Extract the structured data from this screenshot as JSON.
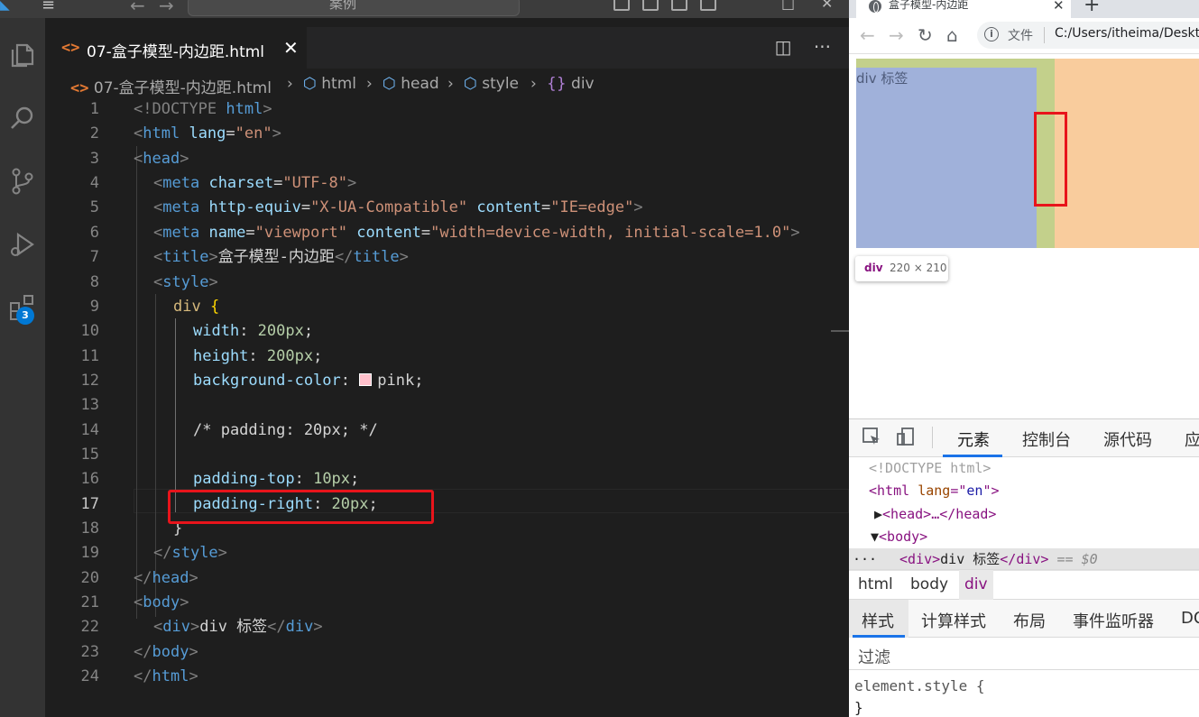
{
  "vscode": {
    "command_center_text": "案例",
    "tab": {
      "label": "07-盒子模型-内边距.html",
      "close": "✕",
      "icon_text": "<>"
    },
    "tab_actions": {
      "split": "◫",
      "more": "···"
    },
    "extensions_badge": "3",
    "breadcrumb": [
      {
        "label": "07-盒子模型-内边距.html",
        "icon": "html-file-icon"
      },
      {
        "label": "html",
        "icon": "cube-icon"
      },
      {
        "label": "head",
        "icon": "cube-icon"
      },
      {
        "label": "style",
        "icon": "cube-icon"
      },
      {
        "label": "div",
        "icon": "selector-icon"
      }
    ],
    "current_line": 17,
    "code_lines": [
      "1",
      "2",
      "3",
      "4",
      "5",
      "6",
      "7",
      "8",
      "9",
      "10",
      "11",
      "12",
      "13",
      "14",
      "15",
      "16",
      "17",
      "18",
      "19",
      "20",
      "21",
      "22",
      "23",
      "24"
    ],
    "code": {
      "l1": [
        "<!DOCTYPE ",
        "html",
        ">"
      ],
      "l2": [
        "<",
        "html",
        " ",
        "lang",
        "=",
        "\"en\"",
        ">"
      ],
      "l3": [
        "<",
        "head",
        ">"
      ],
      "l4": [
        "<",
        "meta",
        " ",
        "charset",
        "=",
        "\"UTF-8\"",
        ">"
      ],
      "l5": [
        "<",
        "meta",
        " ",
        "http-equiv",
        "=",
        "\"X-UA-Compatible\"",
        " ",
        "content",
        "=",
        "\"IE=edge\"",
        ">"
      ],
      "l6": [
        "<",
        "meta",
        " ",
        "name",
        "=",
        "\"viewport\"",
        " ",
        "content",
        "=",
        "\"width=device-width, initial-scale=1.0\"",
        ">"
      ],
      "l7": [
        "<",
        "title",
        ">",
        "盒子模型-内边距",
        "</",
        "title",
        ">"
      ],
      "l8": [
        "<",
        "style",
        ">"
      ],
      "l9": [
        "div",
        " {"
      ],
      "l10": [
        "width",
        ": ",
        "200px",
        ";"
      ],
      "l11": [
        "height",
        ": ",
        "200px",
        ";"
      ],
      "l12": [
        "background-color",
        ": ",
        "pink",
        ";"
      ],
      "l14": "/* padding: 20px; */",
      "l16": [
        "padding-top",
        ": ",
        "10px",
        ";"
      ],
      "l17": [
        "padding-right",
        ": ",
        "20px",
        ";"
      ],
      "l18": "}",
      "l19": [
        "</",
        "style",
        ">"
      ],
      "l20": [
        "</",
        "head",
        ">"
      ],
      "l21": [
        "<",
        "body",
        ">"
      ],
      "l22": [
        "<",
        "div",
        ">",
        "div 标签",
        "</",
        "div",
        ">"
      ],
      "l23": [
        "</",
        "body",
        ">"
      ],
      "l24": [
        "</",
        "html",
        ">"
      ]
    }
  },
  "browser": {
    "tab_title": "盒子模型-内边距",
    "tab_close": "✕",
    "new_tab": "+",
    "omnibox_label": "文件",
    "url": "C:/Users/itheima/Desktop",
    "page_text": "div 标签",
    "tooltip_tag": "div",
    "tooltip_size": "220 × 210",
    "devtools": {
      "tabs": [
        "元素",
        "控制台",
        "源代码",
        "应"
      ],
      "dom": {
        "doctype": "<!DOCTYPE html>",
        "html_open": [
          "<html ",
          "lang",
          "=\"",
          "en",
          "\">"
        ],
        "head": "<head>…</head>",
        "body": "<body>",
        "div_text": "div 标签",
        "selected_suffix": "== $0",
        "ellipsis": "···"
      },
      "crumbs": [
        "html",
        "body",
        "div"
      ],
      "sub_tabs": [
        "样式",
        "计算样式",
        "布局",
        "事件监听器",
        "DO"
      ],
      "filter_label": "过滤",
      "styles": [
        "element.style {",
        "}"
      ]
    }
  },
  "colors": {
    "swatch_pink": "#ffc0cb",
    "highlight_red": "#e8141b"
  }
}
